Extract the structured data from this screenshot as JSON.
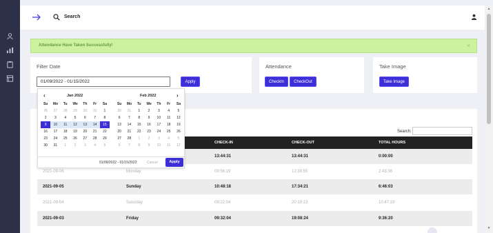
{
  "header": {
    "search_label": "Search"
  },
  "alert": {
    "message": "Attendance Have Taken Successfully!",
    "close": "×"
  },
  "filter": {
    "title": "Filter Date",
    "date_range": "01/09/2022 - 01/15/2022",
    "apply_label": "Apply"
  },
  "attendance": {
    "title": "Attendance",
    "checkin_label": "CheckIn",
    "checkout_label": "CheckOut"
  },
  "take_image": {
    "title": "Take Image",
    "button_label": "Take Image"
  },
  "calendar": {
    "prev": "‹",
    "next": "›",
    "left_month": "Jan 2022",
    "right_month": "Feb 2022",
    "weekdays": [
      "Su",
      "Mo",
      "Tu",
      "We",
      "Th",
      "Fr",
      "Sa"
    ],
    "left_weeks": [
      [
        "26",
        "27",
        "28",
        "29",
        "30",
        "31",
        "1"
      ],
      [
        "2",
        "3",
        "4",
        "5",
        "6",
        "7",
        "8"
      ],
      [
        "9",
        "10",
        "11",
        "12",
        "13",
        "14",
        "15"
      ],
      [
        "16",
        "17",
        "18",
        "19",
        "20",
        "21",
        "22"
      ],
      [
        "23",
        "24",
        "25",
        "26",
        "27",
        "28",
        "29"
      ],
      [
        "30",
        "31",
        "1",
        "2",
        "3",
        "4",
        "5"
      ]
    ],
    "right_weeks": [
      [
        "30",
        "31",
        "1",
        "2",
        "3",
        "4",
        "5"
      ],
      [
        "6",
        "7",
        "8",
        "9",
        "10",
        "11",
        "12"
      ],
      [
        "13",
        "14",
        "15",
        "16",
        "17",
        "18",
        "19"
      ],
      [
        "20",
        "21",
        "22",
        "23",
        "24",
        "25",
        "26"
      ],
      [
        "27",
        "28",
        "1",
        "2",
        "3",
        "4",
        "5"
      ],
      [
        "6",
        "7",
        "8",
        "9",
        "10",
        "11",
        "12"
      ]
    ],
    "selected_range": "01/09/2022 - 01/15/2022",
    "cancel_label": "Cancel",
    "apply_label": "Apply"
  },
  "table": {
    "search_label": "Search:",
    "columns": [
      "CHECK-IN",
      "CHECK-OUT",
      "TOTAL HOURS"
    ],
    "rows": [
      {
        "date": "",
        "day": "",
        "checkin": "13:44:31",
        "checkout": "13:44:31",
        "total": "0:00:00"
      },
      {
        "date": "2021-09-06",
        "day": "Monday",
        "checkin": "09:56:19",
        "checkout": "12:39:55",
        "total": "2:43:36"
      },
      {
        "date": "2021-09-05",
        "day": "Sunday",
        "checkin": "10:48:18",
        "checkout": "17:34:21",
        "total": "6:46:03"
      },
      {
        "date": "2021-09-04",
        "day": "Saturday",
        "checkin": "09:22:04",
        "checkout": "20:19:23",
        "total": "10:47:19"
      },
      {
        "date": "2021-09-03",
        "day": "Friday",
        "checkin": "09:32:04",
        "checkout": "19:08:24",
        "total": "9:36:20"
      }
    ]
  },
  "colors": {
    "sidebar": "#2c3147",
    "primary": "#3d2fd8",
    "alert_bg": "#ccf2a0",
    "table_head": "#222222"
  }
}
